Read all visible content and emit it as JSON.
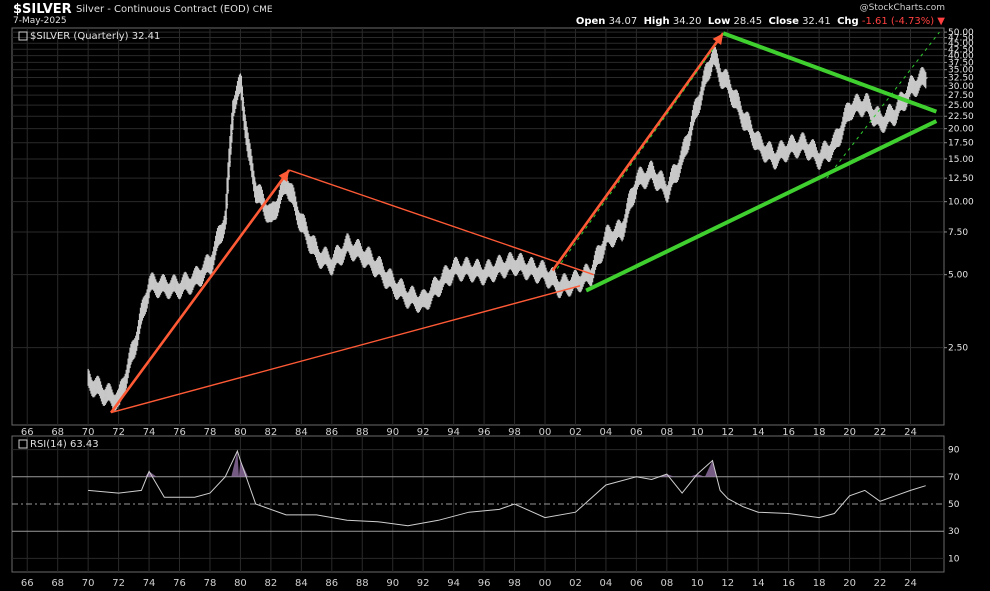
{
  "header": {
    "ticker": "$SILVER",
    "description": "Silver - Continuous Contract (EOD)",
    "exchange": "CME",
    "date": "7-May-2025",
    "watermark": "@StockCharts.com",
    "open_label": "Open",
    "open": "34.07",
    "high_label": "High",
    "high": "34.20",
    "low_label": "Low",
    "low": "28.45",
    "close_label": "Close",
    "close": "32.41",
    "chg_label": "Chg",
    "chg": "-1.61 (-4.73%)",
    "chg_arrow": "▼"
  },
  "price_panel": {
    "legend": "$SILVER (Quarterly) 32.41",
    "y_scale": "log",
    "y_ticks": [
      "50.00",
      "47.50",
      "45.00",
      "42.50",
      "40.00",
      "37.50",
      "35.00",
      "32.50",
      "30.00",
      "27.50",
      "25.00",
      "22.50",
      "20.00",
      "17.50",
      "15.00",
      "12.50",
      "10.00",
      "7.50",
      "5.00",
      "2.50"
    ]
  },
  "rsi_panel": {
    "legend": "RSI(14) 63.43",
    "y_ticks": [
      "90",
      "70",
      "50",
      "30",
      "10"
    ]
  },
  "x_ticks": [
    "66",
    "68",
    "70",
    "72",
    "74",
    "76",
    "78",
    "80",
    "82",
    "84",
    "86",
    "88",
    "90",
    "92",
    "94",
    "96",
    "98",
    "00",
    "02",
    "04",
    "06",
    "08",
    "10",
    "12",
    "14",
    "16",
    "18",
    "20",
    "22",
    "24"
  ],
  "colors": {
    "background": "#000000",
    "bars": "#c8c8c8",
    "orange_lines": "#ff5a36",
    "green_lines": "#3fcf2f",
    "green_dotted": "#2fd02f",
    "rsi_fill": "#8a6a9a",
    "grid": "#2a2a2a"
  },
  "chart_data": {
    "type": "ohlc",
    "title": "$SILVER (Quarterly)",
    "series": [
      {
        "name": "$SILVER (Quarterly)",
        "x": [
          1970,
          1971,
          1972,
          1973,
          1974,
          1975,
          1976,
          1977,
          1978,
          1979,
          1979.5,
          1980,
          1980.5,
          1981,
          1982,
          1983,
          1984,
          1985,
          1986,
          1987,
          1988,
          1989,
          1990,
          1991,
          1992,
          1993,
          1994,
          1995,
          1996,
          1997,
          1998,
          1999,
          2000,
          2001,
          2002,
          2003,
          2004,
          2005,
          2006,
          2007,
          2008,
          2009,
          2010,
          2011,
          2011.5,
          2012,
          2013,
          2014,
          2015,
          2016,
          2017,
          2018,
          2019,
          2020,
          2021,
          2022,
          2023,
          2024,
          2025
        ],
        "values": [
          1.8,
          1.6,
          1.5,
          2.5,
          4.5,
          4.4,
          4.4,
          4.7,
          5.5,
          8.5,
          25,
          30,
          16,
          11,
          8.5,
          12,
          8,
          6,
          5.5,
          6.5,
          6,
          5.3,
          4.5,
          4,
          3.8,
          4.5,
          5.2,
          5.2,
          5,
          5.3,
          5.5,
          5.2,
          5,
          4.4,
          4.6,
          5,
          7,
          7.5,
          12,
          13,
          11,
          15,
          25,
          40,
          33,
          30,
          22,
          17,
          15,
          16.5,
          17,
          15,
          17,
          24,
          25,
          21,
          23,
          29,
          32.41
        ]
      }
    ],
    "rsi": {
      "name": "RSI(14)",
      "x": [
        1970,
        1972,
        1973.5,
        1974,
        1975,
        1977,
        1978,
        1979,
        1979.8,
        1980,
        1981,
        1983,
        1985,
        1987,
        1989,
        1991,
        1993,
        1995,
        1997,
        1998,
        2000,
        2002,
        2004,
        2006,
        2007,
        2008,
        2009,
        2010,
        2011,
        2011.5,
        2012,
        2013,
        2014,
        2016,
        2018,
        2019,
        2020,
        2021,
        2022,
        2023,
        2024,
        2025
      ],
      "values": [
        60,
        58,
        60,
        74,
        55,
        55,
        58,
        70,
        89,
        82,
        50,
        42,
        42,
        38,
        37,
        34,
        38,
        44,
        46,
        50,
        40,
        44,
        64,
        70,
        68,
        72,
        58,
        72,
        82,
        60,
        54,
        48,
        44,
        43,
        40,
        43,
        56,
        60,
        52,
        56,
        60,
        63.43
      ]
    },
    "annotations": {
      "orange_trendlines": [
        {
          "from": [
            1971.5,
            1.35
          ],
          "to": [
            1983.2,
            13.5
          ]
        },
        {
          "from": [
            1983.2,
            13.5
          ],
          "to": [
            2003.2,
            5.0
          ]
        },
        {
          "from": [
            1971.5,
            1.35
          ],
          "to": [
            2002.3,
            4.5
          ]
        },
        {
          "from": [
            2000.5,
            5.2
          ],
          "to": [
            2011.7,
            49.5
          ]
        }
      ],
      "green_trendlines": [
        {
          "from": [
            2002.7,
            4.3
          ],
          "to": [
            2025.7,
            21.5
          ]
        },
        {
          "from": [
            2011.7,
            49.5
          ],
          "to": [
            2025.7,
            23.5
          ]
        }
      ],
      "green_dotted": [
        {
          "from": [
            2000.8,
            5.3
          ],
          "to": [
            2011.2,
            44
          ]
        },
        {
          "from": [
            2018.5,
            12.5
          ],
          "to": [
            2025.9,
            50
          ]
        }
      ]
    },
    "xlabel": "",
    "ylabel": "",
    "ylim": [
      1.2,
      52
    ],
    "rsi_ylim": [
      0,
      100
    ],
    "grid": true
  }
}
